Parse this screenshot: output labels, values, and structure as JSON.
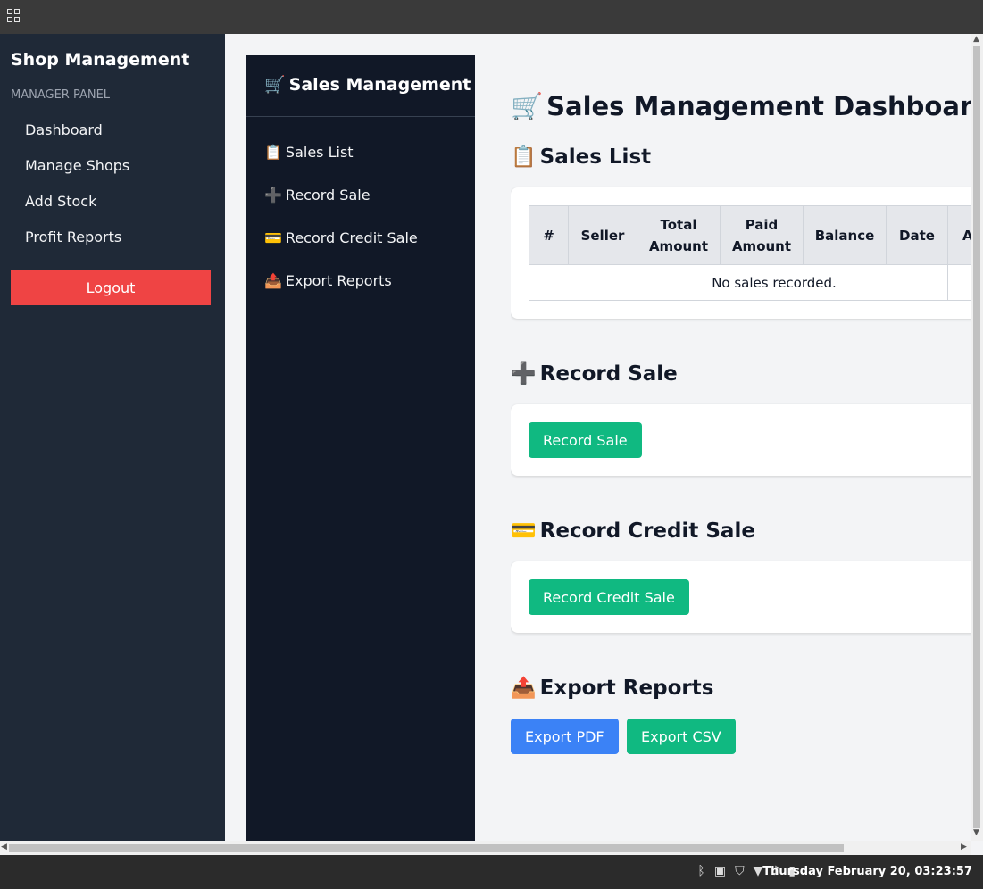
{
  "manager_sidebar": {
    "title": "Shop Management",
    "subtitle": "MANAGER PANEL",
    "items": [
      {
        "label": "Dashboard"
      },
      {
        "label": "Manage Shops"
      },
      {
        "label": "Add Stock"
      },
      {
        "label": "Profit Reports"
      }
    ],
    "logout_label": "Logout"
  },
  "sales_sidebar": {
    "title": "Sales Management",
    "title_emoji": "🛒",
    "items": [
      {
        "emoji": "📋",
        "label": "Sales List"
      },
      {
        "emoji": "➕",
        "label": "Record Sale"
      },
      {
        "emoji": "💳",
        "label": "Record Credit Sale"
      },
      {
        "emoji": "📤",
        "label": "Export Reports"
      }
    ]
  },
  "main": {
    "title_emoji": "🛒",
    "title": "Sales Management Dashboard",
    "sales_list": {
      "emoji": "📋",
      "heading": "Sales List",
      "columns": [
        "#",
        "Seller",
        "Total Amount",
        "Paid Amount",
        "Balance",
        "Date",
        "A"
      ],
      "empty_message": "No sales recorded."
    },
    "record_sale": {
      "emoji": "➕",
      "heading": "Record Sale",
      "button": "Record Sale"
    },
    "record_credit_sale": {
      "emoji": "💳",
      "heading": "Record Credit Sale",
      "button": "Record Credit Sale"
    },
    "export_reports": {
      "emoji": "📤",
      "heading": "Export Reports",
      "pdf_button": "Export PDF",
      "csv_button": "Export CSV"
    }
  },
  "taskbar": {
    "clock": "Thursday February 20, 03:23:57",
    "tray_icons": [
      "bluetooth-icon",
      "clipboard-icon",
      "shield-icon",
      "wifi-icon",
      "volume-icon",
      "battery-icon"
    ]
  },
  "colors": {
    "manager_sidebar_bg": "#1f2937",
    "sales_sidebar_bg": "#111827",
    "logout": "#ef4444",
    "green_button": "#10b981",
    "blue_button": "#3b82f6"
  }
}
